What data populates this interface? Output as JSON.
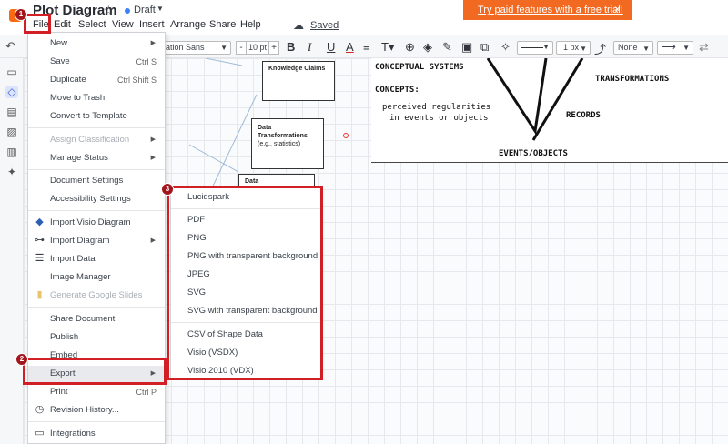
{
  "title_bar": {
    "doc_title": "Plot Diagram",
    "status": "Draft",
    "saved": "Saved",
    "menus": [
      "File",
      "Edit",
      "Select",
      "View",
      "Insert",
      "Arrange",
      "Share",
      "Help"
    ]
  },
  "banner": {
    "text": "Try paid features with a free trial!",
    "close": "×"
  },
  "toolbar": {
    "font": "eration Sans",
    "font_size": "10 pt",
    "size_minus": "-",
    "size_plus": "+",
    "line_width": "1 px",
    "arrow_start": "None"
  },
  "canvas": {
    "knowledge_claims": "Knowledge Claims",
    "data_transformations": "Data Transformations",
    "data_transformations_sub": "(e.g., statistics)",
    "data_box": "Data",
    "vee": {
      "conceptual_systems": "CONCEPTUAL SYSTEMS",
      "concepts": "CONCEPTS:",
      "concepts_line1": "perceived regularities",
      "concepts_line2": "in events or objects",
      "transformations": "TRANSFORMATIONS",
      "records": "RECORDS",
      "events_objects": "EVENTS/OBJECTS"
    }
  },
  "file_menu": {
    "new": "New",
    "save": "Save",
    "save_shortcut": "Ctrl S",
    "duplicate": "Duplicate",
    "duplicate_shortcut": "Ctrl Shift S",
    "move_to_trash": "Move to Trash",
    "convert_to_template": "Convert to Template",
    "assign_classification": "Assign Classification",
    "manage_status": "Manage Status",
    "document_settings": "Document Settings",
    "accessibility_settings": "Accessibility Settings",
    "import_visio": "Import Visio Diagram",
    "import_diagram": "Import Diagram",
    "import_data": "Import Data",
    "image_manager": "Image Manager",
    "generate_google_slides": "Generate Google Slides",
    "share_document": "Share Document",
    "publish": "Publish",
    "embed": "Embed",
    "export": "Export",
    "print": "Print",
    "print_shortcut": "Ctrl P",
    "revision_history": "Revision History...",
    "integrations": "Integrations"
  },
  "export_menu": [
    "Lucidspark",
    "PDF",
    "PNG",
    "PNG with transparent background",
    "JPEG",
    "SVG",
    "SVG with transparent background",
    "CSV of Shape Data",
    "Visio (VSDX)",
    "Visio 2010 (VDX)"
  ],
  "annotations": {
    "step1": "1",
    "step2": "2",
    "step3": "3"
  },
  "colors": {
    "accent": "#f26a22",
    "annotation_red": "#d21f26",
    "badge": "#a4161d"
  }
}
